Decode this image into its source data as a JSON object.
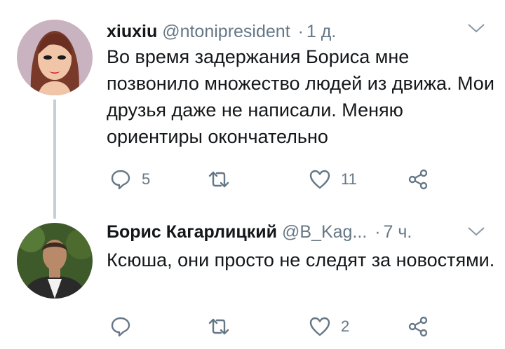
{
  "tweets": [
    {
      "name": "xiuxiu",
      "handle": "@ntonipresident",
      "time": "1 д.",
      "text": "Во время задержания Бориса мне позвонило множество людей из движа. Мои друзья даже не написали. Меняю ориентиры окончательно",
      "replies": "5",
      "retweets": "",
      "likes": "11"
    },
    {
      "name": "Борис Кагарлицкий",
      "handle": "@B_Kag...",
      "time": "7 ч.",
      "text": "Ксюша, они просто не следят за новостями.",
      "replies": "",
      "retweets": "",
      "likes": "2"
    }
  ],
  "colors": {
    "icon": "#657786",
    "name": "#14171a",
    "thread_line": "#c4cfd6"
  }
}
